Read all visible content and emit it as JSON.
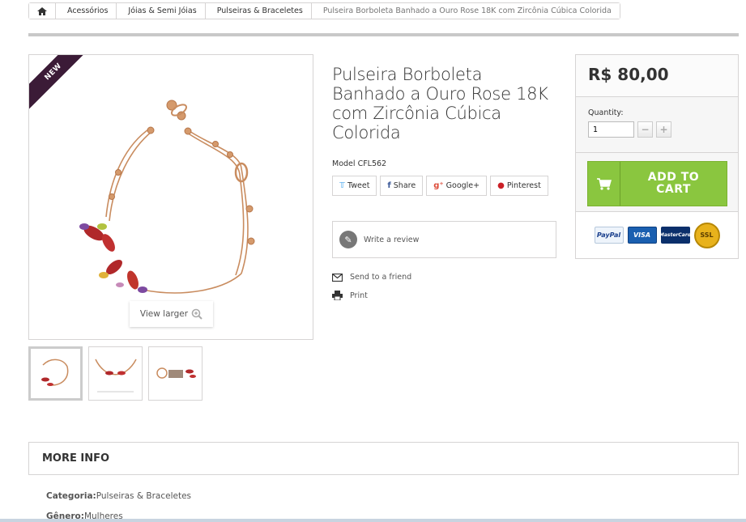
{
  "breadcrumb": {
    "home_icon": "home-icon",
    "items": [
      "Acessórios",
      "Jóias & Semi Jóias",
      "Pulseiras & Braceletes"
    ],
    "current": "Pulseira Borboleta Banhado a Ouro Rose 18K com Zircônia Cúbica Colorida"
  },
  "product": {
    "ribbon": "NEW",
    "view_larger": "View larger",
    "title": "Pulseira Borboleta Banhado a Ouro Rose 18K com Zircônia Cúbica Colorida",
    "model_label": "Model",
    "model_value": "CFL562",
    "thumbnail_count": 3
  },
  "social": {
    "tweet": "Tweet",
    "share": "Share",
    "googleplus": "Google+",
    "pinterest": "Pinterest"
  },
  "actions": {
    "write_review": "Write a review",
    "send_friend": "Send to a friend",
    "print": "Print"
  },
  "buybox": {
    "price": "R$ 80,00",
    "quantity_label": "Quantity:",
    "quantity_value": "1",
    "minus": "−",
    "plus": "+",
    "add_to_cart_line1": "ADD TO",
    "add_to_cart_line2": "CART",
    "accent_color": "#8ac63f",
    "payment_logos": [
      "PayPal",
      "VISA",
      "MasterCard",
      "SSL"
    ]
  },
  "more_info": {
    "heading": "MORE INFO",
    "features": [
      {
        "label": "Categoria:",
        "value": "Pulseiras & Braceletes"
      },
      {
        "label": "Gênero:",
        "value": "Mulheres"
      }
    ]
  }
}
